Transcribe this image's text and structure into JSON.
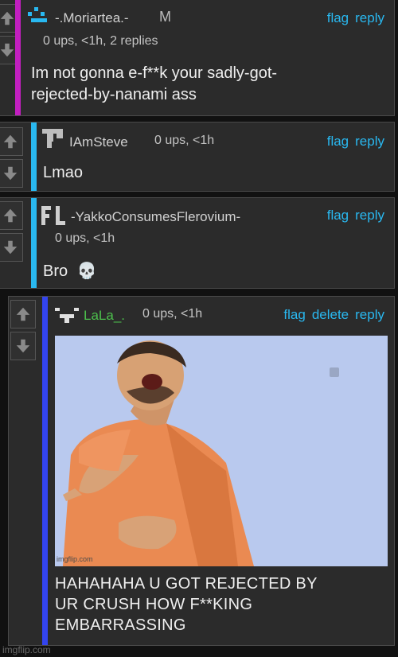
{
  "comments": [
    {
      "username": "-.Moriartea.-",
      "badge": "M",
      "meta": "0 ups, <1h, 2 replies",
      "actions": [
        "flag",
        "reply"
      ],
      "text_lines": [
        "Im not gonna e-f**k your sadly-got-",
        "rejected-by-nanami ass"
      ],
      "bar_color": "#c21fc0"
    },
    {
      "username": "IAmSteve",
      "meta": "0 ups, <1h",
      "actions": [
        "flag",
        "reply"
      ],
      "text": "Lmao",
      "bar_color": "#29b8f0"
    },
    {
      "username": "-YakkoConsumesFlerovium-",
      "meta": "0 ups, <1h",
      "actions": [
        "flag",
        "reply"
      ],
      "text": "Bro",
      "emoji": "💀",
      "bar_color": "#29b8f0"
    },
    {
      "username": "LaLa_.",
      "meta": "0 ups, <1h",
      "actions": [
        "flag",
        "delete",
        "reply"
      ],
      "caption_lines": [
        "HAHAHAHA U GOT REJECTED BY",
        "UR CRUSH HOW F**KING",
        "EMBARRASSING"
      ],
      "meme_watermark": "imgflip.com",
      "bar_color": "#3344ee",
      "username_color": "#4cc04c"
    }
  ],
  "footer_watermark": "imgflip.com",
  "colors": {
    "link": "#29b8f0",
    "background": "#111111",
    "card": "#2b2b2b"
  },
  "icons": {
    "upvote": "up-arrow-icon",
    "downvote": "down-arrow-icon"
  }
}
